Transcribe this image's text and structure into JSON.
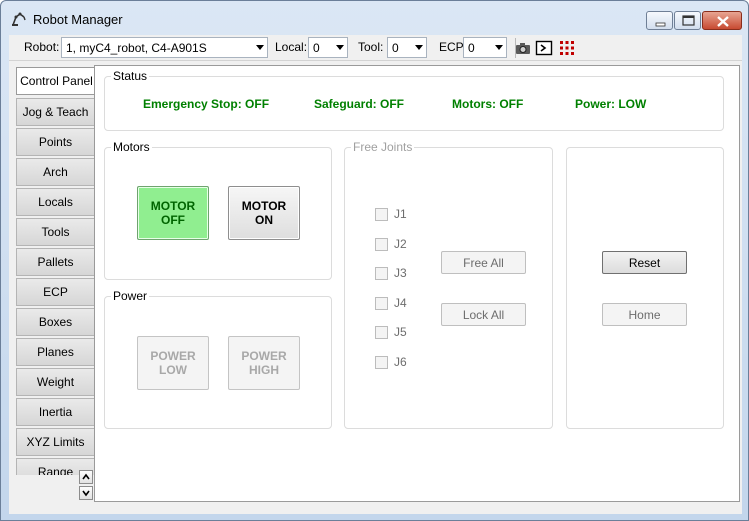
{
  "window": {
    "title": "Robot Manager"
  },
  "toolbar": {
    "robot_label": "Robot:",
    "robot_value": "1, myC4_robot, C4-A901S",
    "local_label": "Local:",
    "local_value": "0",
    "tool_label": "Tool:",
    "tool_value": "0",
    "ecp_label": "ECP:",
    "ecp_value": "0"
  },
  "tabs": [
    {
      "label": "Control Panel"
    },
    {
      "label": "Jog & Teach"
    },
    {
      "label": "Points"
    },
    {
      "label": "Arch"
    },
    {
      "label": "Locals"
    },
    {
      "label": "Tools"
    },
    {
      "label": "Pallets"
    },
    {
      "label": "ECP"
    },
    {
      "label": "Boxes"
    },
    {
      "label": "Planes"
    },
    {
      "label": "Weight"
    },
    {
      "label": "Inertia"
    },
    {
      "label": "XYZ Limits"
    },
    {
      "label": "Range"
    }
  ],
  "status": {
    "title": "Status",
    "emergency_stop": "Emergency Stop: OFF",
    "safeguard": "Safeguard: OFF",
    "motors": "Motors: OFF",
    "power": "Power: LOW"
  },
  "motors_group": {
    "title": "Motors",
    "off_label": "MOTOR OFF",
    "on_label": "MOTOR ON"
  },
  "power_group": {
    "title": "Power",
    "low_label": "POWER LOW",
    "high_label": "POWER HIGH"
  },
  "free_joints": {
    "title": "Free Joints",
    "joints": [
      "J1",
      "J2",
      "J3",
      "J4",
      "J5",
      "J6"
    ],
    "free_all_label": "Free All",
    "lock_all_label": "Lock All"
  },
  "actions": {
    "reset_label": "Reset",
    "home_label": "Home"
  },
  "colors": {
    "status_green": "#008000",
    "motor_off_bg": "#90ee90"
  }
}
